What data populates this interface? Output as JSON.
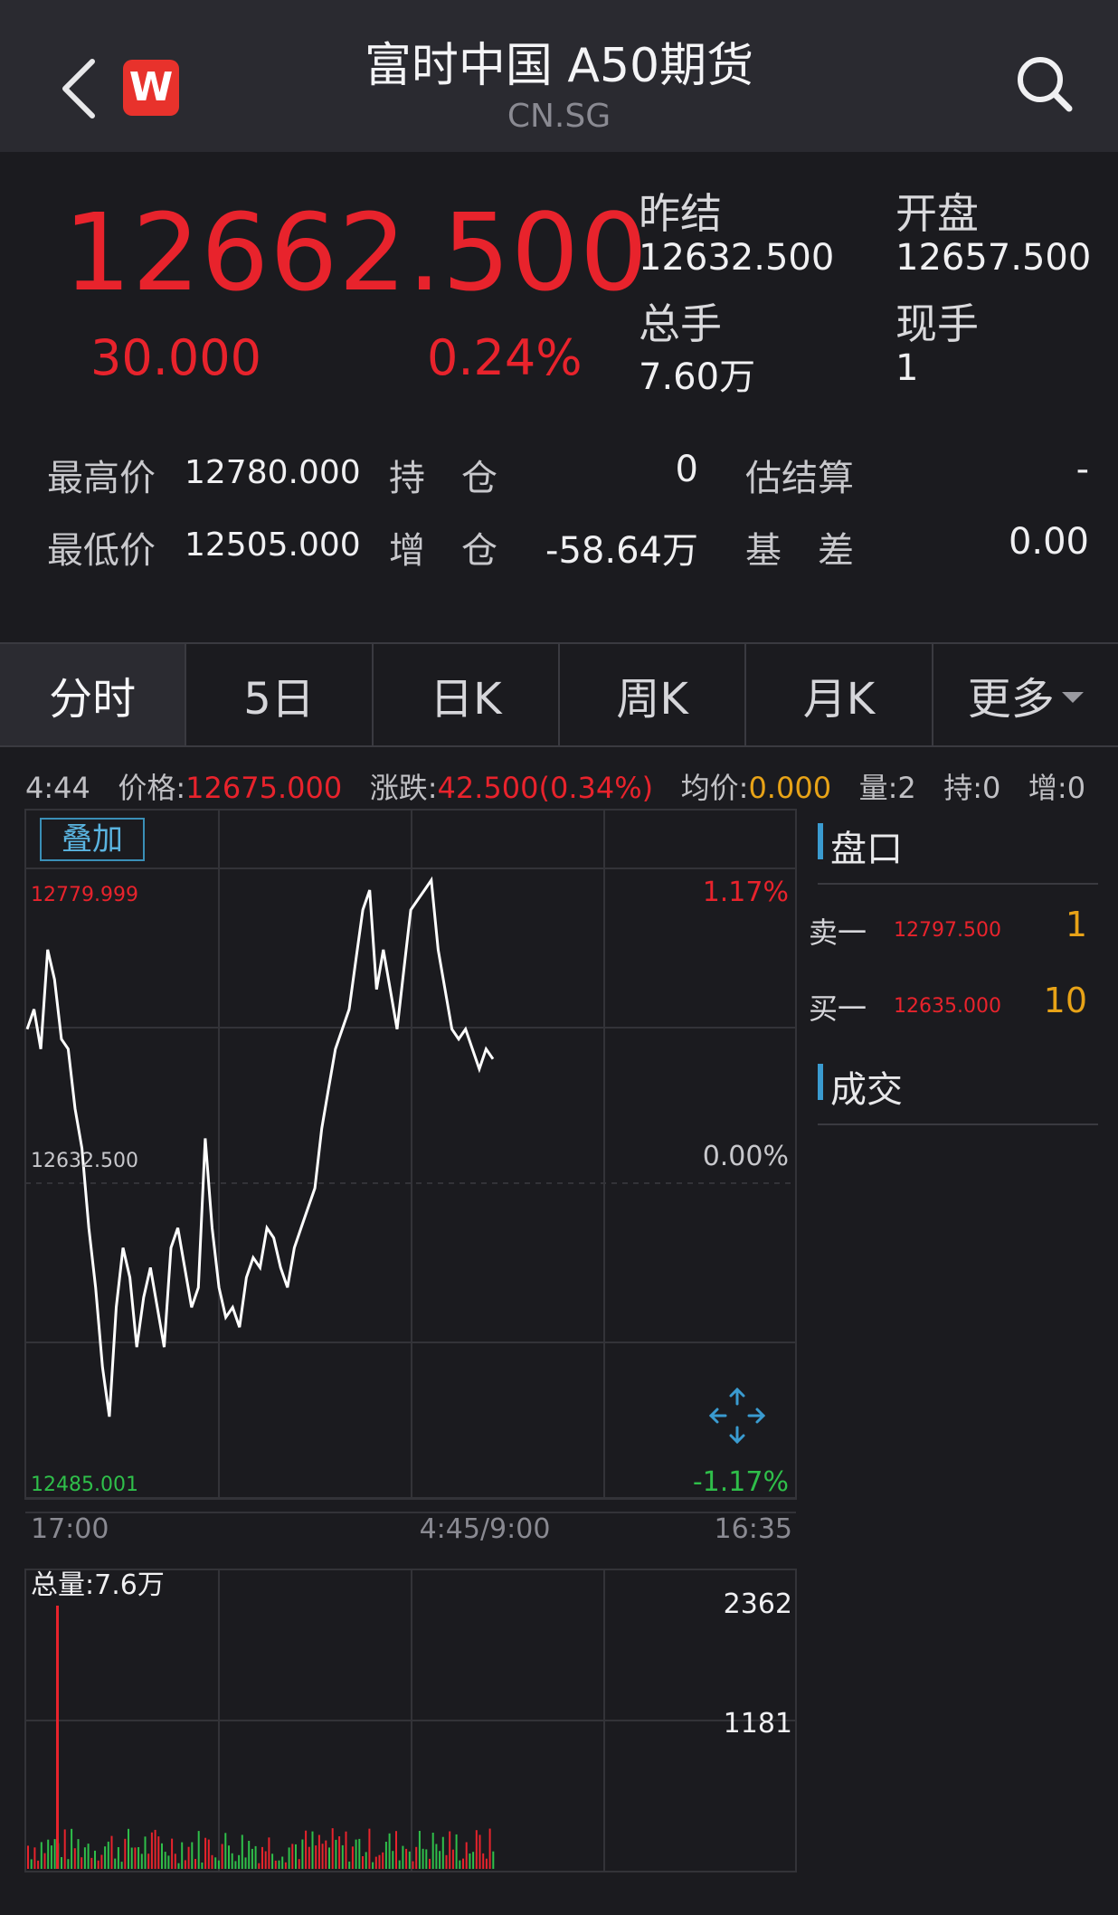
{
  "header": {
    "title": "富时中国 A50期货",
    "subtitle": "CN.SG",
    "logo_letter": "W"
  },
  "quote": {
    "price": "12662.500",
    "change": "30.000",
    "change_pct": "0.24%",
    "prev_settle_label": "昨结",
    "prev_settle": "12632.500",
    "open_label": "开盘",
    "open": "12657.500",
    "total_volume_label": "总手",
    "total_volume": "7.60万",
    "current_volume_label": "现手",
    "current_volume": "1"
  },
  "stats": {
    "high_label": "最高价",
    "high": "12780.000",
    "low_label": "最低价",
    "low": "12505.000",
    "oi_label": "持　仓",
    "oi": "0",
    "oi_change_label": "增　仓",
    "oi_change": "-58.64万",
    "est_settle_label": "估结算",
    "est_settle": "-",
    "basis_label": "基　差",
    "basis": "0.00"
  },
  "tabs": [
    "分时",
    "5日",
    "日K",
    "周K",
    "月K",
    "更多"
  ],
  "infoline": {
    "time": "4:44",
    "price_label": "价格:",
    "price": "12675.000",
    "change_label": "涨跌:",
    "change": "42.500(0.34%)",
    "avg_label": "均价:",
    "avg": "0.000",
    "vol_label": "量:",
    "vol": "2",
    "oi_label": "持:",
    "oi": "0",
    "inc_label": "增:",
    "inc": "0"
  },
  "chart": {
    "overlay_label": "叠加",
    "y_high": "12779.999",
    "y_mid": "12632.500",
    "y_low": "12485.001",
    "pct_high": "1.17%",
    "pct_mid": "0.00%",
    "pct_low": "-1.17%",
    "x_start": "17:00",
    "x_mid": "4:45/9:00",
    "x_end": "16:35",
    "volume_label": "总量:7.6万",
    "vol_axis_high": "2362",
    "vol_axis_mid": "1181"
  },
  "orderbook": {
    "title": "盘口",
    "ask_label": "卖一",
    "ask_price": "12797.500",
    "ask_qty": "1",
    "bid_label": "买一",
    "bid_price": "12635.000",
    "bid_qty": "10",
    "trades_title": "成交"
  },
  "chart_data": {
    "type": "line",
    "y_range": [
      12485.001,
      12779.999
    ],
    "prev_settle": 12632.5,
    "x_range_label": [
      "17:00",
      "4:45/9:00",
      "16:35"
    ],
    "price_series": [
      12700,
      12710,
      12690,
      12740,
      12725,
      12695,
      12690,
      12660,
      12640,
      12600,
      12570,
      12530,
      12505,
      12560,
      12590,
      12575,
      12540,
      12565,
      12580,
      12560,
      12540,
      12590,
      12600,
      12580,
      12560,
      12570,
      12645,
      12600,
      12570,
      12555,
      12560,
      12550,
      12575,
      12585,
      12580,
      12600,
      12595,
      12580,
      12570,
      12590,
      12600,
      12610,
      12620,
      12650,
      12670,
      12690,
      12700,
      12710,
      12735,
      12760,
      12770,
      12720,
      12740,
      12720,
      12700,
      12730,
      12760,
      12765,
      12770,
      12775,
      12740,
      12720,
      12700,
      12695,
      12700,
      12690,
      12680,
      12690,
      12685
    ],
    "volume_axis": [
      1181,
      2362
    ],
    "volume_spike": 2362
  }
}
